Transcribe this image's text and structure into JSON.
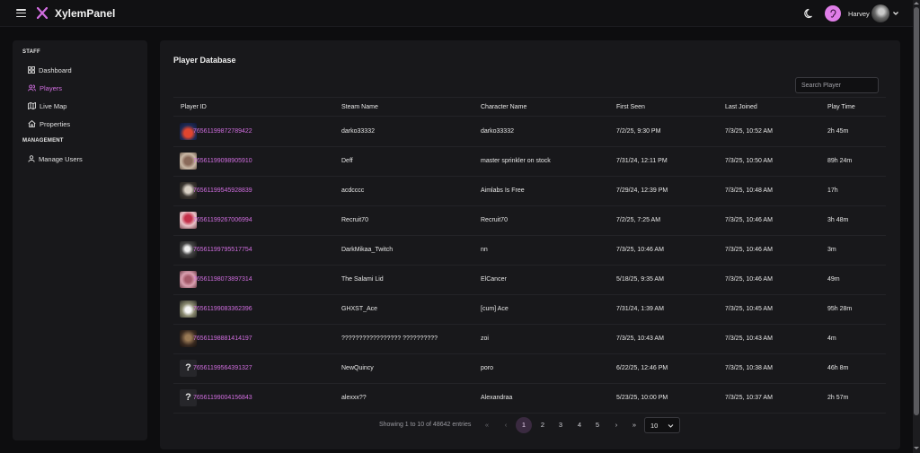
{
  "app": {
    "title": "XylemPanel",
    "brand_color": "#d16ee0"
  },
  "topbar": {
    "username": "Harvey"
  },
  "sidebar": {
    "sections": [
      {
        "label": "STAFF",
        "items": [
          {
            "label": "Dashboard",
            "icon": "grid-icon"
          },
          {
            "label": "Players",
            "icon": "users-icon",
            "active": true
          },
          {
            "label": "Live Map",
            "icon": "map-icon"
          },
          {
            "label": "Properties",
            "icon": "home-icon"
          }
        ]
      },
      {
        "label": "MANAGEMENT",
        "items": [
          {
            "label": "Manage Users",
            "icon": "user-icon"
          }
        ]
      }
    ]
  },
  "main": {
    "title": "Player Database",
    "search_placeholder": "Search Player",
    "columns": [
      "Player ID",
      "Steam Name",
      "Character Name",
      "First Seen",
      "Last Joined",
      "Play Time"
    ],
    "rows": [
      {
        "id": "76561199872789422",
        "steam": "darko33332",
        "character": "darko33332",
        "first_seen": "7/2/25, 9:30 PM",
        "last_joined": "7/3/25, 10:52 AM",
        "play_time": "2h 45m",
        "avatar": "image"
      },
      {
        "id": "76561199098905910",
        "steam": "Deff",
        "character": "master sprinkler on stock",
        "first_seen": "7/31/24, 12:11 PM",
        "last_joined": "7/3/25, 10:50 AM",
        "play_time": "89h 24m",
        "avatar": "image"
      },
      {
        "id": "76561199545928839",
        "steam": "acdcccc",
        "character": "Aimlabs Is Free",
        "first_seen": "7/29/24, 12:39 PM",
        "last_joined": "7/3/25, 10:48 AM",
        "play_time": "17h",
        "avatar": "image"
      },
      {
        "id": "76561199267006994",
        "steam": "Recruit70",
        "character": "Recruit70",
        "first_seen": "7/2/25, 7:25 AM",
        "last_joined": "7/3/25, 10:46 AM",
        "play_time": "3h 48m",
        "avatar": "image"
      },
      {
        "id": "76561199795517754",
        "steam": "DarkMikaa_Twitch",
        "character": "nn",
        "first_seen": "7/3/25, 10:46 AM",
        "last_joined": "7/3/25, 10:46 AM",
        "play_time": "3m",
        "avatar": "image"
      },
      {
        "id": "76561198073897314",
        "steam": "The Salami Lid",
        "character": "ElCancer",
        "first_seen": "5/18/25, 9:35 AM",
        "last_joined": "7/3/25, 10:46 AM",
        "play_time": "49m",
        "avatar": "image"
      },
      {
        "id": "76561199083362396",
        "steam": "GHXST_Ace",
        "character": "[cum] Ace",
        "first_seen": "7/31/24, 1:39 AM",
        "last_joined": "7/3/25, 10:45 AM",
        "play_time": "95h 28m",
        "avatar": "image"
      },
      {
        "id": "76561198881414197",
        "steam": "????????????????? ??????????",
        "character": "zoi",
        "first_seen": "7/3/25, 10:43 AM",
        "last_joined": "7/3/25, 10:43 AM",
        "play_time": "4m",
        "avatar": "image"
      },
      {
        "id": "76561199564391327",
        "steam": "NewQuincy",
        "character": "poro",
        "first_seen": "6/22/25, 12:46 PM",
        "last_joined": "7/3/25, 10:38 AM",
        "play_time": "46h 8m",
        "avatar": "?"
      },
      {
        "id": "76561199004156843",
        "steam": "alexxx??",
        "character": "Alexandraa",
        "first_seen": "5/23/25, 10:00 PM",
        "last_joined": "7/3/25, 10:37 AM",
        "play_time": "2h 57m",
        "avatar": "?"
      }
    ],
    "pagination": {
      "info": "Showing 1 to 10 of 48642 entries",
      "first": "«",
      "prev": "‹",
      "pages": [
        "1",
        "2",
        "3",
        "4",
        "5"
      ],
      "next": "›",
      "last": "»",
      "page_size": "10"
    }
  }
}
